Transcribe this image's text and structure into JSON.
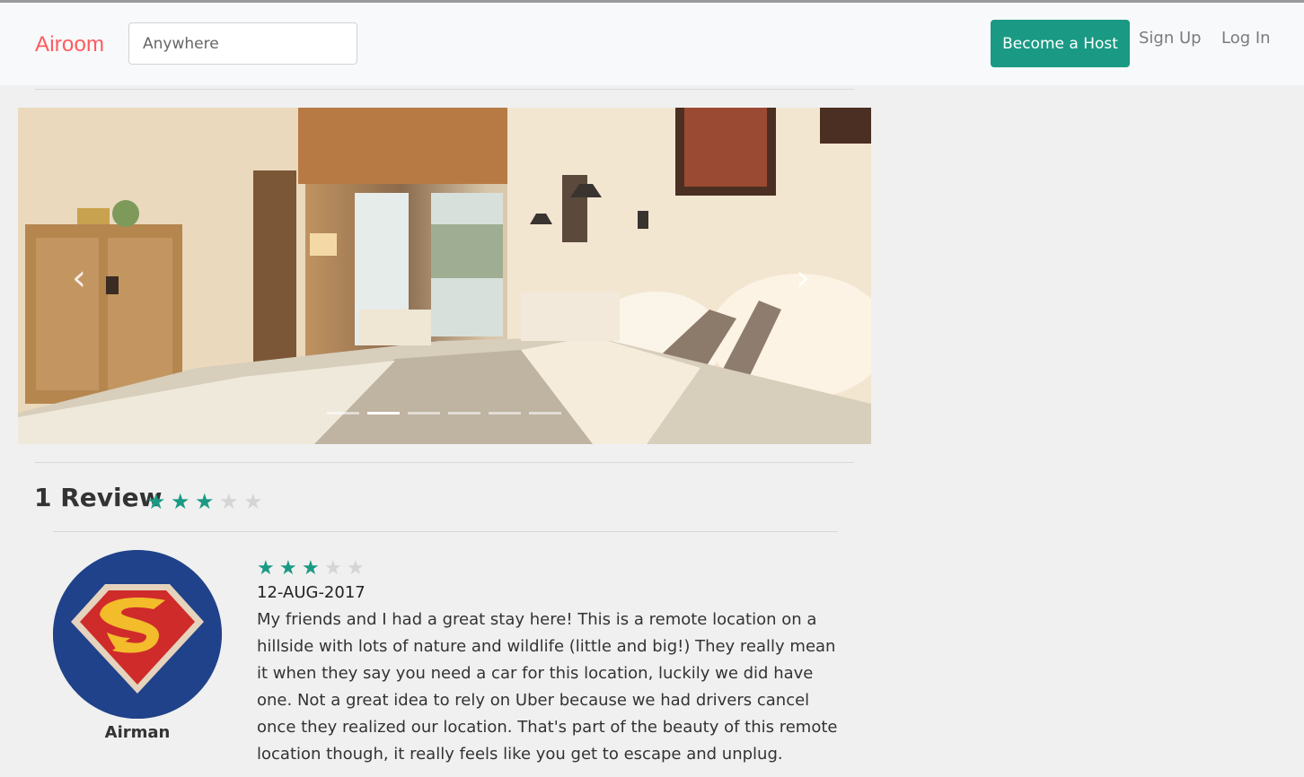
{
  "navbar": {
    "brand": "Airoom",
    "search_placeholder": "Anywhere",
    "become_host_label": "Become a Host",
    "sign_up_label": "Sign Up",
    "log_in_label": "Log In"
  },
  "carousel": {
    "prev_icon": "chevron-left-icon",
    "next_icon": "chevron-right-icon",
    "prev_glyph": "‹",
    "next_glyph": "›",
    "slide_count": 6,
    "active_slide": 2
  },
  "reviews": {
    "title": "1 Review",
    "rating": 3,
    "max_rating": 5,
    "items": [
      {
        "reviewer": "Airman",
        "rating": 3,
        "date": "12-AUG-2017",
        "text": "My friends and I had a great stay here! This is a remote location on a hillside with lots of nature and wildlife (little and big!) They really mean it when they say you need a car for this location, luckily we did have one. Not a great idea to rely on Uber because we had drivers cancel once they realized our location. That's part of the beauty of this remote location though, it really feels like you get to escape and unplug."
      }
    ]
  },
  "colors": {
    "brand": "#ff5a5f",
    "accent": "#1a9a84",
    "star_off": "#d5d5d5"
  }
}
